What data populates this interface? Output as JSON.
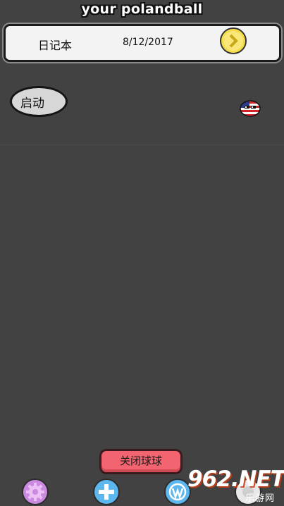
{
  "app": {
    "title": "your polandball"
  },
  "diary": {
    "label": "日记本",
    "date": "8/12/2017",
    "next_icon": "chevron-right-icon"
  },
  "controls": {
    "start_label": "启动",
    "close_balls_label": "关闭球球"
  },
  "characters": [
    {
      "name": "usa-ball"
    }
  ],
  "bottom_bar": {
    "buttons": [
      {
        "icon": "gear-icon"
      },
      {
        "icon": "plus-icon"
      },
      {
        "icon": "wordpress-icon"
      },
      {
        "icon": "extra-icon"
      }
    ]
  },
  "watermark": {
    "brand": "962.NET",
    "sub": "乐游网"
  },
  "colors": {
    "background": "#424242",
    "close_button": "#f2646f",
    "next_button": "#f6dd4a",
    "settings_button": "#c98ae0",
    "blue_button": "#5db7ef"
  }
}
